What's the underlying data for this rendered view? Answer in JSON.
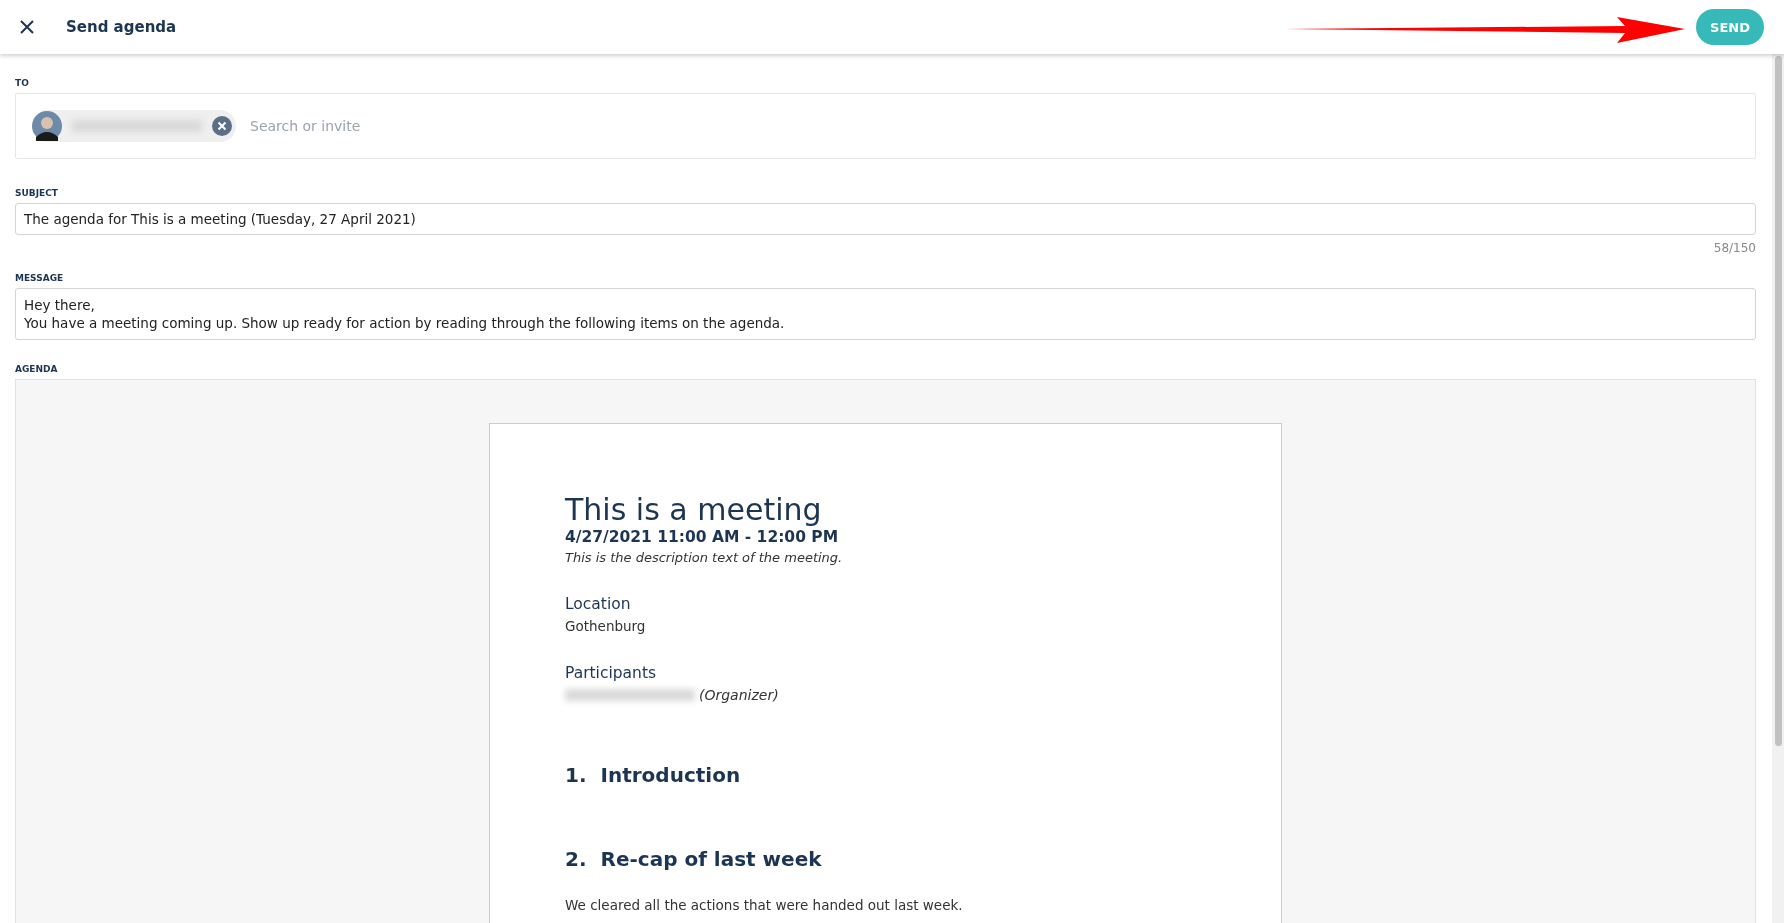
{
  "header": {
    "title": "Send agenda",
    "send_button": "SEND",
    "annotation": {
      "kind": "arrow"
    }
  },
  "to": {
    "label": "TO",
    "recipients": [
      {
        "kind": "chip"
      }
    ],
    "placeholder": "Search or invite"
  },
  "subject": {
    "label": "SUBJECT",
    "value": "The agenda for This is a meeting (Tuesday, 27 April 2021)",
    "counter": "58/150"
  },
  "message": {
    "label": "MESSAGE",
    "lines": [
      "Hey there,",
      "You have a meeting coming up. Show up ready for action by reading through the following items on the agenda."
    ]
  },
  "agenda": {
    "label": "AGENDA",
    "document": {
      "title": "This is a meeting",
      "time": "4/27/2021 11:00 AM - 12:00 PM",
      "description": "This is the description text of the meeting.",
      "location_label": "Location",
      "location": "Gothenburg",
      "participants_label": "Participants",
      "participants": [
        {
          "kind": "blurred",
          "role": "(Organizer)"
        }
      ],
      "items": [
        {
          "number": "1.",
          "title": "Introduction"
        },
        {
          "number": "2.",
          "title": "Re-cap of last week",
          "text": "We cleared all the actions that were handed out last week."
        }
      ]
    }
  }
}
